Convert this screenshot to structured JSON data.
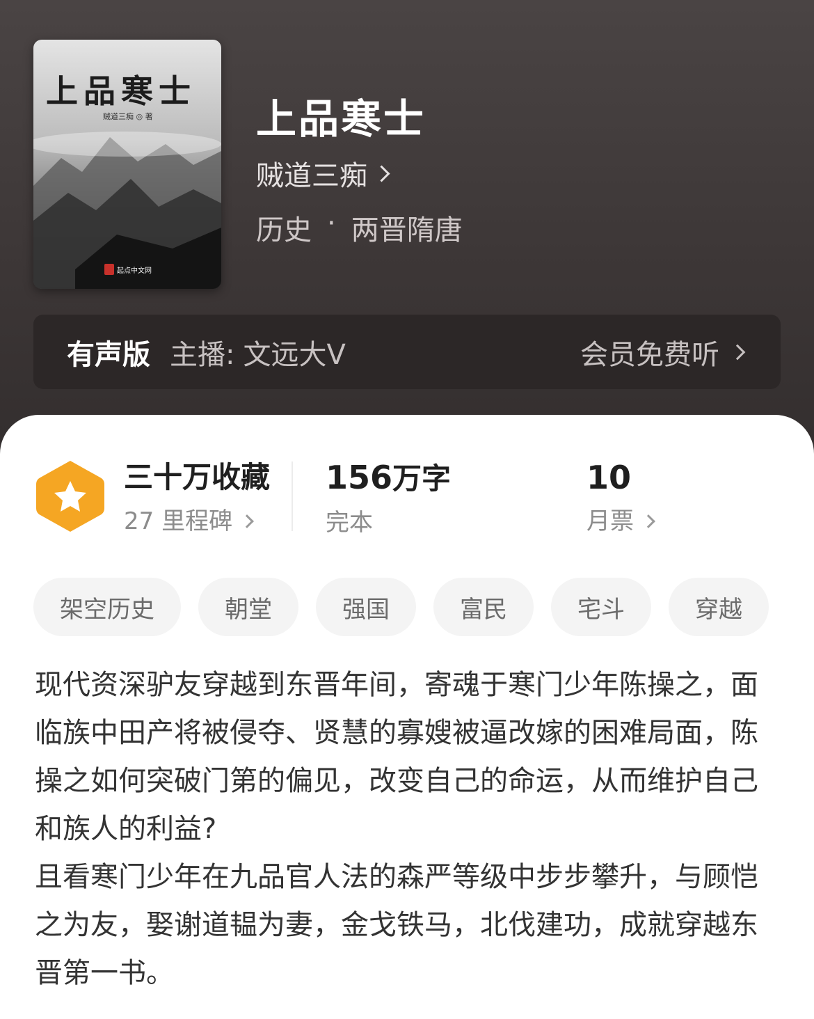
{
  "colors": {
    "header_bg": "#3d3737",
    "audio_bar_bg": "#2c2727",
    "badge": "#f5a623",
    "text_primary": "#1f1f1f",
    "text_secondary": "#8c8c8c",
    "tag_bg": "#f4f4f4"
  },
  "cover": {
    "title": "上品寒士",
    "author": "贼道三痴 ◎ 著",
    "publisher": "起点中文网"
  },
  "book": {
    "title": "上品寒士",
    "author": "贼道三痴",
    "category": "历史",
    "separator": "·",
    "subcategory": "两晋隋唐"
  },
  "audio": {
    "label": "有声版",
    "narrator_label": "主播:",
    "narrator_name": "文远大V",
    "action": "会员免费听"
  },
  "stats": {
    "collections": "三十万收藏",
    "milestones": "27 里程碑",
    "word_count_number": "156",
    "word_count_unit": "万字",
    "status": "完本",
    "monthly_tickets": "10",
    "monthly_tickets_label": "月票"
  },
  "tags": [
    "架空历史",
    "朝堂",
    "强国",
    "富民",
    "宅斗",
    "穿越"
  ],
  "description": {
    "paragraph1": "现代资深驴友穿越到东晋年间，寄魂于寒门少年陈操之，面临族中田产将被侵夺、贤慧的寡嫂被逼改嫁的困难局面，陈操之如何突破门第的偏见，改变自己的命运，从而维护自己和族人的利益?",
    "paragraph2": "且看寒门少年在九品官人法的森严等级中步步攀升，与顾恺之为友，娶谢道韫为妻，金戈铁马，北伐建功，成就穿越东晋第一书。"
  },
  "icons": {
    "badge": "star-hexagon-icon",
    "chevron": "chevron-right-icon"
  }
}
